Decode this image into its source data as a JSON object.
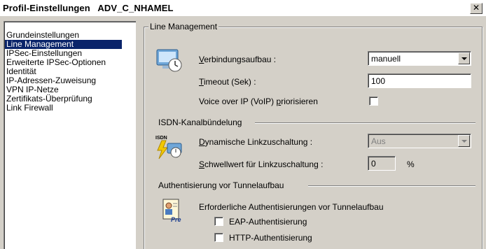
{
  "window": {
    "title": "Profil-Einstellungen   ADV_C_NHAMEL",
    "close_glyph": "✕"
  },
  "nav": {
    "items": [
      {
        "label": "Grundeinstellungen",
        "selected": false
      },
      {
        "label": "Line Management",
        "selected": true
      },
      {
        "label": "IPSec-Einstellungen",
        "selected": false
      },
      {
        "label": "Erweiterte IPSec-Optionen",
        "selected": false
      },
      {
        "label": "Identität",
        "selected": false
      },
      {
        "label": "IP-Adressen-Zuweisung",
        "selected": false
      },
      {
        "label": "VPN IP-Netze",
        "selected": false
      },
      {
        "label": "Zertifikats-Überprüfung",
        "selected": false
      },
      {
        "label": "Link Firewall",
        "selected": false
      }
    ]
  },
  "line_management": {
    "group_title": "Line Management",
    "connection_label_u": "V",
    "connection_label_rest": "erbindungsaufbau :",
    "connection_value": "manuell",
    "timeout_label_u": "T",
    "timeout_label_rest": "imeout (Sek) :",
    "timeout_value": "100",
    "voip_label_pre": "Voice over IP (VoIP) ",
    "voip_label_u": "p",
    "voip_label_rest": "riorisieren",
    "voip_checked": false,
    "icon": "computer-clock-icon"
  },
  "isdn": {
    "section_title": "ISDN-Kanalbündelung",
    "dynamic_label_u": "D",
    "dynamic_label_rest": "ynamische Linkzuschaltung :",
    "dynamic_value": "Aus",
    "threshold_label_u": "S",
    "threshold_label_rest": "chwellwert für Linkzuschaltung :",
    "threshold_value": "0",
    "threshold_unit": "%",
    "icon": "isdn-icon",
    "icon_text": "ISDN"
  },
  "auth": {
    "section_title": "Authentisierung vor Tunnelaufbau",
    "required_label": "Erforderliche Authentisierungen vor Tunnelaufbau",
    "eap_label": "EAP-Authentisierung",
    "eap_checked": false,
    "http_label": "HTTP-Authentisierung",
    "http_checked": false,
    "icon": "id-card-icon",
    "icon_text": "Pre"
  }
}
